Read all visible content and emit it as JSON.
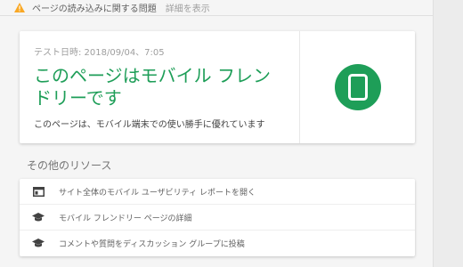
{
  "issue_bar": {
    "text": "ページの読み込みに関する問題",
    "link": "詳細を表示"
  },
  "result_card": {
    "test_date": "テスト日時: 2018/09/04、7:05",
    "title": "このページはモバイル フレンドリーです",
    "subtitle": "このページは、モバイル端末での使い勝手に優れています",
    "status_icon": "mobile-phone-icon",
    "accent_color": "#1e9e58"
  },
  "other_resources": {
    "heading": "その他のリソース",
    "items": [
      {
        "label": "サイト全体のモバイル ユーザビリティ レポートを開く",
        "icon": "report-window-icon"
      },
      {
        "label": "モバイル フレンドリー ページの詳細",
        "icon": "graduation-cap-icon"
      },
      {
        "label": "コメントや質問をディスカッション グループに投稿",
        "icon": "graduation-cap-icon"
      }
    ]
  }
}
